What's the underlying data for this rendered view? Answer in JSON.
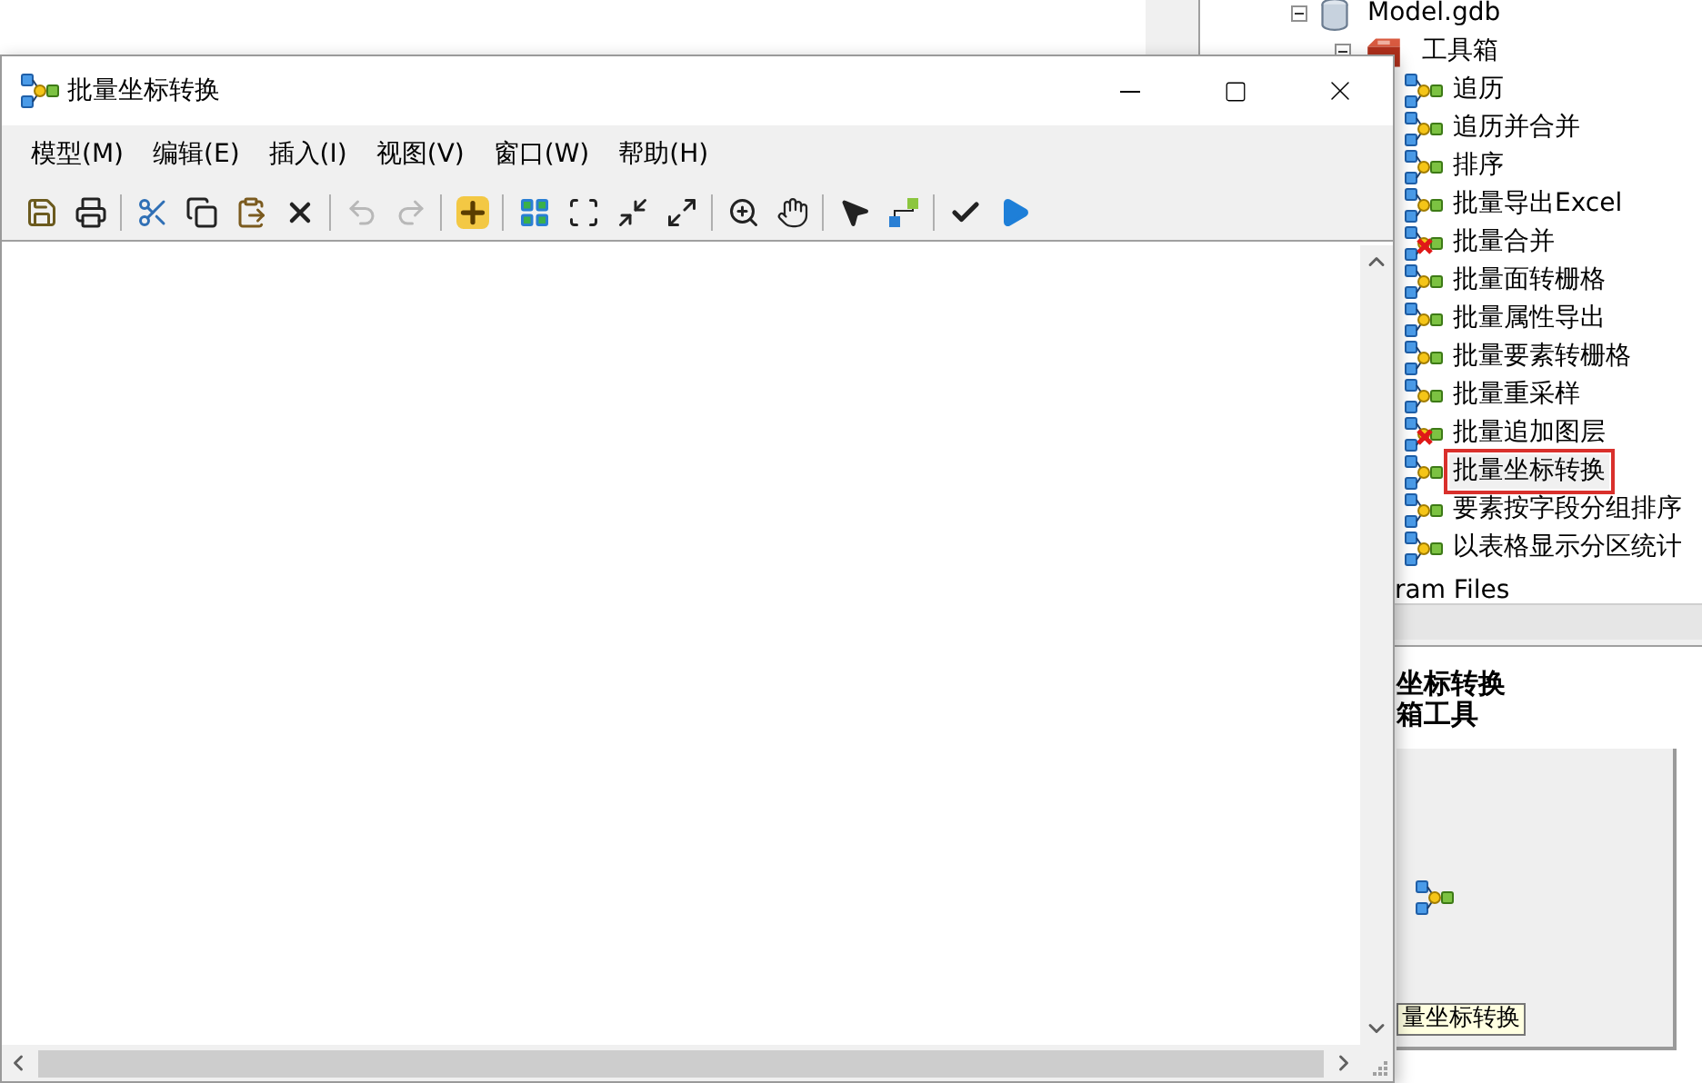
{
  "window": {
    "title": "批量坐标转换"
  },
  "menu": [
    {
      "label": "模型(M)"
    },
    {
      "label": "编辑(E)"
    },
    {
      "label": "插入(I)"
    },
    {
      "label": "视图(V)"
    },
    {
      "label": "窗口(W)"
    },
    {
      "label": "帮助(H)"
    }
  ],
  "toolbar_groups": [
    {
      "items": [
        {
          "kind": "save",
          "disabled": false
        },
        {
          "kind": "print",
          "disabled": false
        }
      ]
    },
    {
      "items": [
        {
          "kind": "cut",
          "disabled": false
        },
        {
          "kind": "copy",
          "disabled": false
        },
        {
          "kind": "paste",
          "disabled": false
        },
        {
          "kind": "delete",
          "disabled": false
        }
      ]
    },
    {
      "items": [
        {
          "kind": "undo",
          "disabled": true
        },
        {
          "kind": "redo",
          "disabled": true
        }
      ]
    },
    {
      "items": [
        {
          "kind": "add-data",
          "disabled": false
        }
      ]
    },
    {
      "items": [
        {
          "kind": "auto-layout",
          "disabled": false
        },
        {
          "kind": "full-extent",
          "disabled": false
        },
        {
          "kind": "zoom-in-fixed",
          "disabled": false
        },
        {
          "kind": "zoom-out-fixed",
          "disabled": false
        }
      ]
    },
    {
      "items": [
        {
          "kind": "zoom",
          "disabled": false
        },
        {
          "kind": "pan",
          "disabled": false
        }
      ]
    },
    {
      "items": [
        {
          "kind": "select",
          "disabled": false
        },
        {
          "kind": "connect",
          "disabled": false
        }
      ]
    },
    {
      "items": [
        {
          "kind": "validate",
          "disabled": false
        },
        {
          "kind": "run",
          "disabled": false
        }
      ]
    }
  ],
  "catalog": {
    "tree": [
      {
        "label": "Model.gdb",
        "kind": "database",
        "expanded": true,
        "children": [
          {
            "label": "工具箱",
            "kind": "toolbox",
            "expanded": true,
            "children": [
              {
                "label": "追历",
                "kind": "model",
                "selected": false
              },
              {
                "label": "追历并合并",
                "kind": "model",
                "selected": false
              },
              {
                "label": "排序",
                "kind": "model",
                "selected": false
              },
              {
                "label": "批量导出Excel",
                "kind": "model",
                "selected": false
              },
              {
                "label": "批量合并",
                "kind": "model-error",
                "selected": false
              },
              {
                "label": "批量面转栅格",
                "kind": "model",
                "selected": false
              },
              {
                "label": "批量属性导出",
                "kind": "model",
                "selected": false
              },
              {
                "label": "批量要素转栅格",
                "kind": "model",
                "selected": false
              },
              {
                "label": "批量重采样",
                "kind": "model",
                "selected": false
              },
              {
                "label": "批量追加图层",
                "kind": "model-error",
                "selected": false
              },
              {
                "label": "批量坐标转换",
                "kind": "model",
                "selected": true
              },
              {
                "label": "要素按字段分组排序",
                "kind": "model",
                "selected": false
              },
              {
                "label": "以表格显示分区统计",
                "kind": "model",
                "selected": false
              }
            ]
          }
        ]
      }
    ],
    "tree_tail": "ram Files",
    "preview": {
      "title_lines": [
        "坐标转换",
        "箱工具"
      ],
      "tooltip": "量坐标转换"
    }
  }
}
